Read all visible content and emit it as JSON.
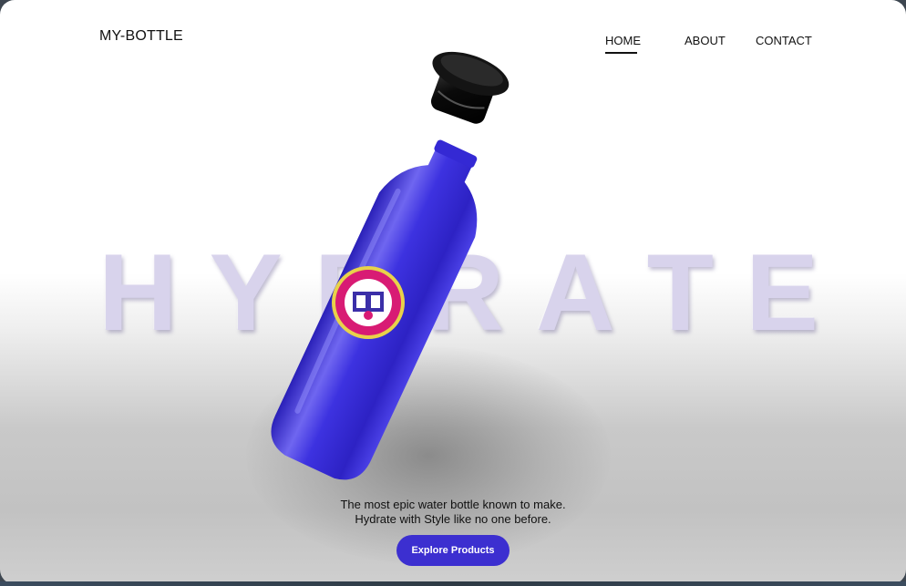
{
  "header": {
    "brand": "MY-BOTTLE",
    "nav": [
      {
        "label": "HOME",
        "active": true
      },
      {
        "label": "ABOUT",
        "active": false
      },
      {
        "label": "CONTACT",
        "active": false
      }
    ]
  },
  "hero": {
    "background_word_letters": [
      "H",
      "Y",
      "D",
      "R",
      "A",
      "T",
      "E"
    ],
    "tagline_line1": "The most epic water bottle known to make.",
    "tagline_line2": "Hydrate with Style like no one before.",
    "cta_label": "Explore Products"
  },
  "colors": {
    "bottle": "#3a2fd6",
    "cap": "#0b0b0b",
    "cta": "#3c2fd0",
    "hero_word": "#d8d3ec"
  },
  "icons": {
    "bottle_badge": "university-seal-icon"
  }
}
